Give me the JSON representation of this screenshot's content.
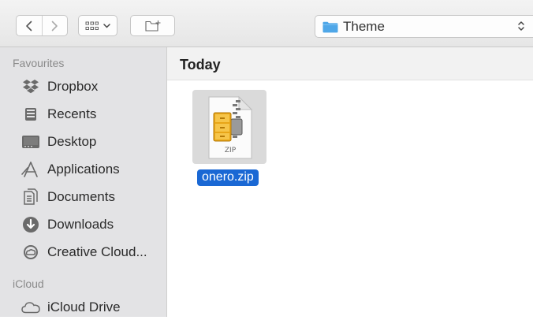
{
  "toolbar": {
    "back_icon": "chevron-left-icon",
    "forward_icon": "chevron-right-icon",
    "view_icon": "icon-grid-icon",
    "view_dropdown_icon": "chevron-down-icon",
    "new_folder_icon": "new-folder-icon",
    "path_popup": {
      "label": "Theme",
      "folder_color": "#4fa7e8",
      "chevron_icon": "up-down-chevron-icon"
    }
  },
  "sidebar": {
    "sections": [
      {
        "heading": "Favourites",
        "items": [
          {
            "label": "Dropbox",
            "icon": "dropbox-icon"
          },
          {
            "label": "Recents",
            "icon": "recents-icon"
          },
          {
            "label": "Desktop",
            "icon": "desktop-icon"
          },
          {
            "label": "Applications",
            "icon": "applications-icon"
          },
          {
            "label": "Documents",
            "icon": "documents-icon"
          },
          {
            "label": "Downloads",
            "icon": "downloads-icon"
          },
          {
            "label": "Creative Cloud...",
            "icon": "creative-cloud-icon"
          }
        ]
      },
      {
        "heading": "iCloud",
        "items": [
          {
            "label": "iCloud Drive",
            "icon": "icloud-icon"
          }
        ]
      }
    ]
  },
  "main": {
    "group_title": "Today",
    "files": [
      {
        "name": "onero.zip",
        "type_label": "ZIP",
        "selected": true,
        "icon": "zip-archive-icon"
      }
    ]
  },
  "colors": {
    "selection": "#1a68d4",
    "sidebar_bg": "#e3e3e5",
    "folder_blue": "#4fa7e8"
  }
}
